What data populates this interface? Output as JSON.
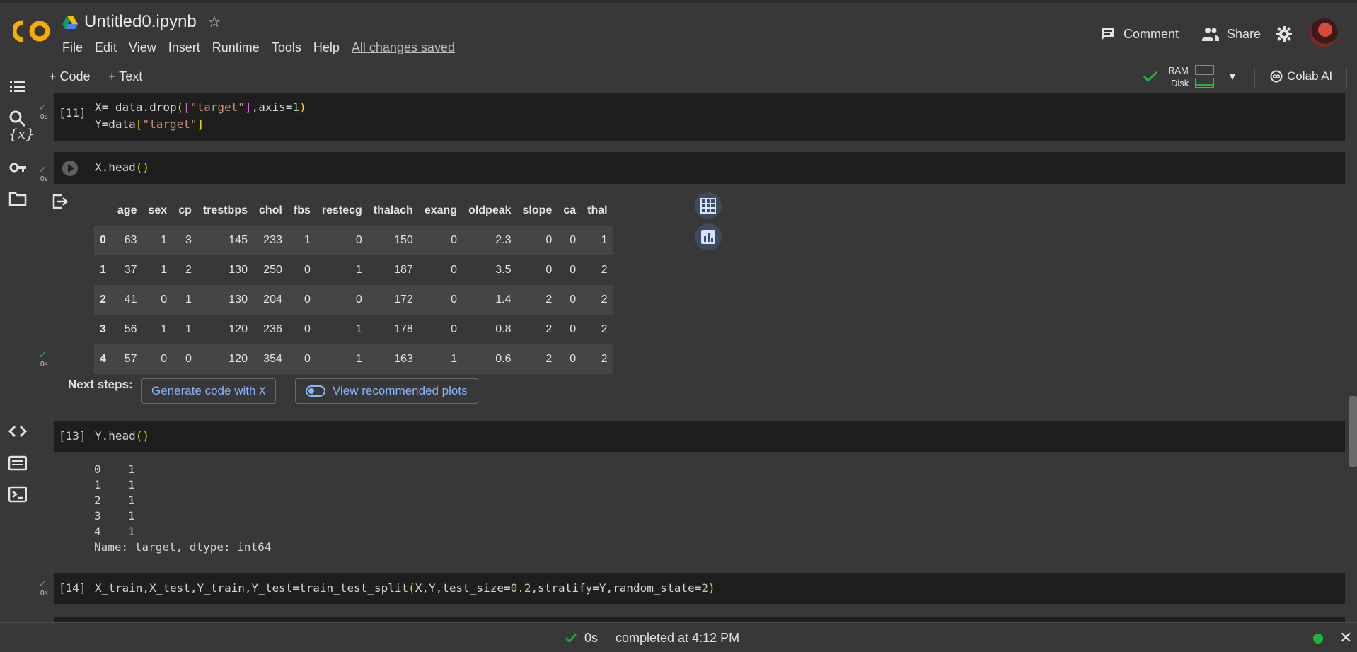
{
  "header": {
    "title": "Untitled0.ipynb",
    "menu": [
      "File",
      "Edit",
      "View",
      "Insert",
      "Runtime",
      "Tools",
      "Help"
    ],
    "saved_status": "All changes saved",
    "comment_label": "Comment",
    "share_label": "Share",
    "logo_text": "CO"
  },
  "toolbar": {
    "add_code": "Code",
    "add_text": "Text",
    "ram_label": "RAM",
    "disk_label": "Disk",
    "colab_ai": "Colab AI"
  },
  "cells": {
    "c11": {
      "exec": "[11]",
      "time": "0s",
      "line1": [
        "X= data.drop",
        "(",
        "[",
        "\"target\"",
        "]",
        ",axis=",
        "1",
        ")"
      ],
      "line2": [
        "Y=data",
        "[",
        "\"target\"",
        "]"
      ]
    },
    "c12": {
      "time": "0s",
      "code_pre": "X.head",
      "code_paren": "()"
    },
    "c13": {
      "exec": "[13]",
      "time": "0s",
      "code_pre": "Y.head",
      "code_paren": "()"
    },
    "c14": {
      "exec": "[14]",
      "time": "0s",
      "code": [
        "X_train,X_test,Y_train,Y_test=train_test_split",
        "(",
        "X,Y,test_size=",
        "0.2",
        ",stratify=Y,random_state=",
        "2",
        ")"
      ]
    }
  },
  "dataframe": {
    "columns": [
      "age",
      "sex",
      "cp",
      "trestbps",
      "chol",
      "fbs",
      "restecg",
      "thalach",
      "exang",
      "oldpeak",
      "slope",
      "ca",
      "thal"
    ],
    "rows": [
      {
        "index": "0",
        "values": [
          "63",
          "1",
          "3",
          "145",
          "233",
          "1",
          "0",
          "150",
          "0",
          "2.3",
          "0",
          "0",
          "1"
        ]
      },
      {
        "index": "1",
        "values": [
          "37",
          "1",
          "2",
          "130",
          "250",
          "0",
          "1",
          "187",
          "0",
          "3.5",
          "0",
          "0",
          "2"
        ]
      },
      {
        "index": "2",
        "values": [
          "41",
          "0",
          "1",
          "130",
          "204",
          "0",
          "0",
          "172",
          "0",
          "1.4",
          "2",
          "0",
          "2"
        ]
      },
      {
        "index": "3",
        "values": [
          "56",
          "1",
          "1",
          "120",
          "236",
          "0",
          "1",
          "178",
          "0",
          "0.8",
          "2",
          "0",
          "2"
        ]
      },
      {
        "index": "4",
        "values": [
          "57",
          "0",
          "0",
          "120",
          "354",
          "0",
          "1",
          "163",
          "1",
          "0.6",
          "2",
          "0",
          "2"
        ]
      }
    ]
  },
  "next_steps": {
    "label": "Next steps:",
    "generate": "Generate code with",
    "generate_var": "X",
    "plots": "View recommended plots"
  },
  "series_output": {
    "lines": [
      "0    1",
      "1    1",
      "2    1",
      "3    1",
      "4    1",
      "Name: target, dtype: int64"
    ]
  },
  "status": {
    "elapsed": "0s",
    "completed": "completed at 4:12 PM"
  },
  "icons": {
    "rail": [
      "toc-icon",
      "search-icon",
      "variables-icon",
      "secrets-icon",
      "files-icon",
      "code-snippets-icon",
      "command-palette-icon",
      "terminal-icon"
    ]
  },
  "colors": {
    "accent_blue": "#8ab4f8",
    "success_green": "#1db53a",
    "logo_orange": "#f9ab00"
  }
}
